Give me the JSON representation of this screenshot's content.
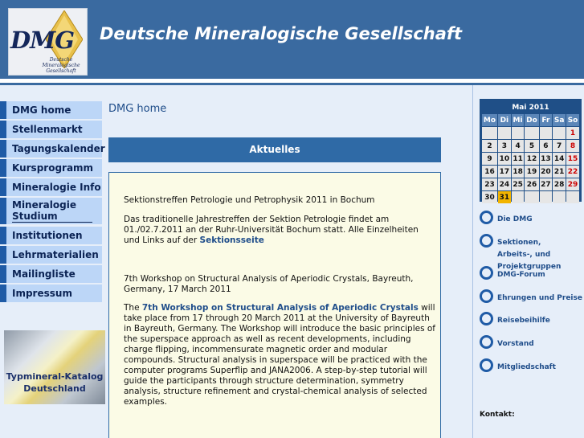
{
  "header": {
    "logo_text": "DMG",
    "logo_subtitle": "Deutsche Mineralogische Gesellschaft",
    "site_title": "Deutsche Mineralogische Gesellschaft"
  },
  "nav": [
    {
      "label": "DMG home"
    },
    {
      "label": "Stellenmarkt"
    },
    {
      "label": "Tagungskalender"
    },
    {
      "label": "Kursprogramm"
    },
    {
      "label": "Mineralogie Info"
    },
    {
      "label": "Mineralogie Studium"
    },
    {
      "label": "Institutionen"
    },
    {
      "label": "Lehrmaterialien"
    },
    {
      "label": "Mailingliste"
    },
    {
      "label": "Impressum"
    }
  ],
  "promo": {
    "label": "Typmineral-Katalog Deutschland"
  },
  "main": {
    "page_title": "DMG home",
    "section_title": "Aktuelles",
    "news": [
      {
        "heading": "Sektionstreffen Petrologie und Petrophysik 2011 in Bochum",
        "body_before": "Das traditionelle Jahrestreffen der Sektion Petrologie findet am 01./02.7.2011 an der Ruhr-Universität Bochum statt. Alle Einzelheiten und Links auf der ",
        "link": "Sektionsseite",
        "body_after": ""
      },
      {
        "heading": "7th Workshop on Structural Analysis of Aperiodic Crystals, Bayreuth, Germany, 17 March 2011",
        "body_before": "The ",
        "link": "7th Workshop on Structural Analysis of Aperiodic Crystals",
        "body_after": " will take place from 17 through 20 March 2011 at the University of Bayreuth in Bayreuth, Germany. The Workshop will introduce the basic principles of the superspace approach as well as recent developments, including charge flipping, incommensurate magnetic order and modular compounds. Structural analysis in superspace will be practiced with the computer programs Superflip and JANA2006. A step-by-step tutorial will guide the participants through structure determination, symmetry analysis, structure refinement and crystal-chemical analysis of selected examples."
      }
    ]
  },
  "calendar": {
    "title": "Mai 2011",
    "weekdays": [
      "Mo",
      "Di",
      "Mi",
      "Do",
      "Fr",
      "Sa",
      "So"
    ],
    "weeks": [
      [
        "",
        "",
        "",
        "",
        "",
        "",
        "1"
      ],
      [
        "2",
        "3",
        "4",
        "5",
        "6",
        "7",
        "8"
      ],
      [
        "9",
        "10",
        "11",
        "12",
        "13",
        "14",
        "15"
      ],
      [
        "16",
        "17",
        "18",
        "19",
        "20",
        "21",
        "22"
      ],
      [
        "23",
        "24",
        "25",
        "26",
        "27",
        "28",
        "29"
      ],
      [
        "30",
        "31",
        "",
        "",
        "",
        "",
        ""
      ]
    ],
    "today": "31",
    "colors": {
      "header": "#1f4f87",
      "weekday_bg": "#5b86b8",
      "day_bg": "#e6e6e6",
      "sunday": "#cc0000",
      "today_bg": "#f2b400"
    }
  },
  "right_links": [
    {
      "label": "Die DMG",
      "icon": "circle-bullet-icon"
    },
    {
      "label": "Sektionen, Arbeits-, und Projektgruppen",
      "icon": "circle-bullet-icon"
    },
    {
      "label": "DMG-Forum",
      "icon": "circle-bullet-icon"
    },
    {
      "label": "Ehrungen und Preise",
      "icon": "circle-bullet-icon"
    },
    {
      "label": "Reisebeihilfe",
      "icon": "circle-bullet-icon"
    },
    {
      "label": "Vorstand",
      "icon": "circle-bullet-icon"
    },
    {
      "label": "Mitgliedschaft",
      "icon": "circle-bullet-icon"
    }
  ],
  "kontakt_label": "Kontakt:",
  "colors": {
    "accent": "#3a6aa0",
    "nav_bg": "#bcd6f7",
    "nav_border": "#1f5ba6",
    "page_bg": "#e6eef9",
    "news_bg": "#fbfbe6"
  }
}
